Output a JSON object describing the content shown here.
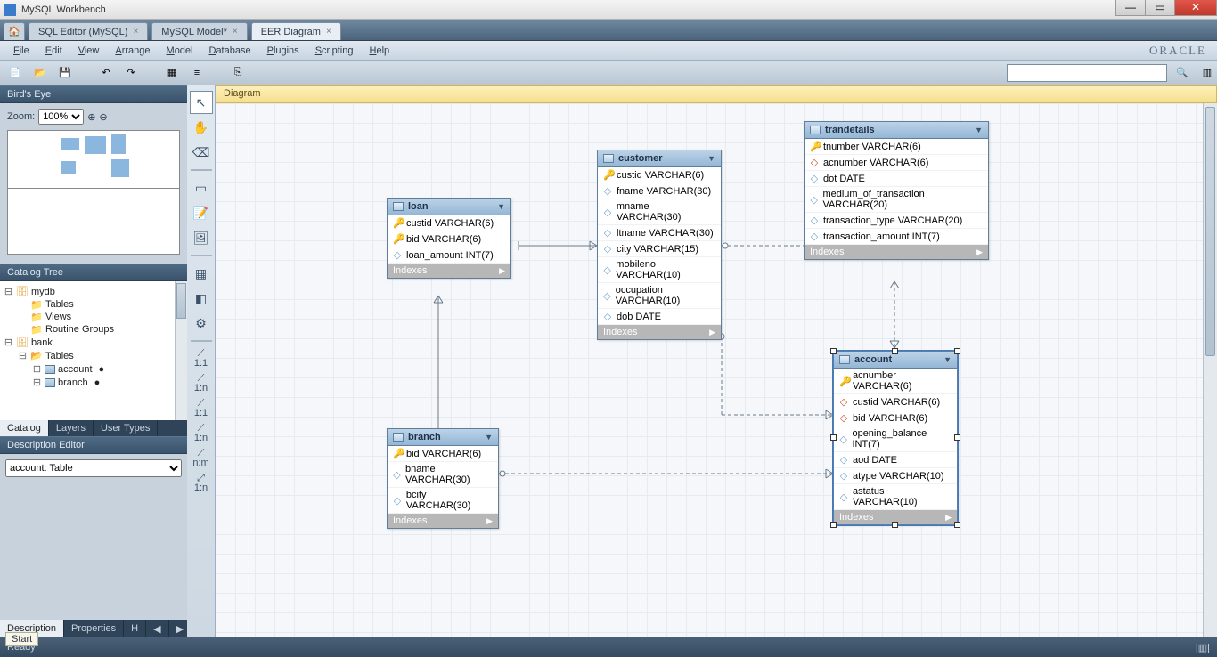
{
  "window": {
    "title": "MySQL Workbench"
  },
  "doctabs": [
    "SQL Editor (MySQL)",
    "MySQL Model*",
    "EER Diagram"
  ],
  "doctabs_active": 2,
  "menu": [
    "File",
    "Edit",
    "View",
    "Arrange",
    "Model",
    "Database",
    "Plugins",
    "Scripting",
    "Help"
  ],
  "brand": "ORACLE",
  "birds_eye": {
    "title": "Bird's Eye",
    "zoom_label": "Zoom:",
    "zoom": "100%"
  },
  "catalog": {
    "title": "Catalog Tree",
    "tabs": [
      "Catalog",
      "Layers",
      "User Types"
    ],
    "active_tab": 0,
    "tree": {
      "db1": "mydb",
      "db1_children": [
        "Tables",
        "Views",
        "Routine Groups"
      ],
      "db2": "bank",
      "db2_tables": [
        "account",
        "branch"
      ]
    }
  },
  "desc": {
    "title": "Description Editor",
    "value": "account: Table",
    "tabs": [
      "Description",
      "Properties",
      "H"
    ]
  },
  "canvas_tab": "Diagram",
  "entities": {
    "loan": {
      "name": "loan",
      "cols": [
        {
          "k": "pk",
          "n": "custid VARCHAR(6)"
        },
        {
          "k": "pk",
          "n": "bid VARCHAR(6)"
        },
        {
          "k": "attr",
          "n": "loan_amount INT(7)"
        }
      ],
      "foot": "Indexes"
    },
    "customer": {
      "name": "customer",
      "cols": [
        {
          "k": "pk",
          "n": "custid VARCHAR(6)"
        },
        {
          "k": "attr",
          "n": "fname VARCHAR(30)"
        },
        {
          "k": "attr",
          "n": "mname VARCHAR(30)"
        },
        {
          "k": "attr",
          "n": "ltname VARCHAR(30)"
        },
        {
          "k": "attr",
          "n": "city VARCHAR(15)"
        },
        {
          "k": "attr",
          "n": "mobileno VARCHAR(10)"
        },
        {
          "k": "attr",
          "n": "occupation VARCHAR(10)"
        },
        {
          "k": "attr",
          "n": "dob DATE"
        }
      ],
      "foot": "Indexes"
    },
    "trandetails": {
      "name": "trandetails",
      "cols": [
        {
          "k": "pk",
          "n": "tnumber VARCHAR(6)"
        },
        {
          "k": "fk",
          "n": "acnumber VARCHAR(6)"
        },
        {
          "k": "attr",
          "n": "dot DATE"
        },
        {
          "k": "attr",
          "n": "medium_of_transaction VARCHAR(20)"
        },
        {
          "k": "attr",
          "n": "transaction_type VARCHAR(20)"
        },
        {
          "k": "attr",
          "n": "transaction_amount INT(7)"
        }
      ],
      "foot": "Indexes"
    },
    "branch": {
      "name": "branch",
      "cols": [
        {
          "k": "pk",
          "n": "bid VARCHAR(6)"
        },
        {
          "k": "attr",
          "n": "bname VARCHAR(30)"
        },
        {
          "k": "attr",
          "n": "bcity VARCHAR(30)"
        }
      ],
      "foot": "Indexes"
    },
    "account": {
      "name": "account",
      "cols": [
        {
          "k": "pk",
          "n": "acnumber VARCHAR(6)"
        },
        {
          "k": "fk",
          "n": "custid VARCHAR(6)"
        },
        {
          "k": "fk",
          "n": "bid VARCHAR(6)"
        },
        {
          "k": "attr",
          "n": "opening_balance INT(7)"
        },
        {
          "k": "attr",
          "n": "aod DATE"
        },
        {
          "k": "attr",
          "n": "atype VARCHAR(10)"
        },
        {
          "k": "attr",
          "n": "astatus VARCHAR(10)"
        }
      ],
      "foot": "Indexes"
    }
  },
  "tool_rels": [
    "1:1",
    "1:n",
    "1:1",
    "1:n",
    "n:m",
    "1:n"
  ],
  "status": "Ready"
}
